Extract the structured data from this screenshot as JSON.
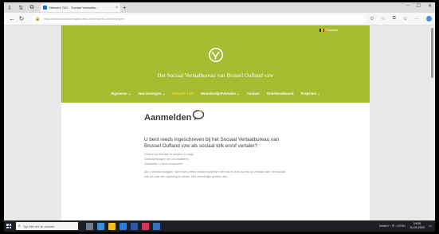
{
  "browser": {
    "tab_title": "Netwerk T&V - Sociaal Vertaalbu...",
    "tab_close": "×",
    "new_tab": "+",
    "tab_ctrl_1": "⇩",
    "tab_ctrl_2": "⇅",
    "tab_ctrl_3": "⧉",
    "url": "https://www.socialvertaalbureau.be/netwerk-tv/ontvangen/",
    "win_min": "–",
    "win_max": "☐",
    "win_close": "✕",
    "back": "←",
    "refresh": "↻",
    "more": "···"
  },
  "site": {
    "language": "Français",
    "title": "Het Sociaal Vertaalbureau van Brussel Oufland vzw",
    "nav": [
      {
        "label": "Algemeen ⌄"
      },
      {
        "label": "Voorzieningen ⌄"
      },
      {
        "label": "Netwerk T&V"
      },
      {
        "label": "Woordenlijst/Vertalen ⌄"
      },
      {
        "label": "Contact"
      },
      {
        "label": "Onbekendwoord"
      },
      {
        "label": "Projecten ⌄"
      }
    ],
    "brand": "Aanmelden",
    "question": "U bent reeds ingeschreven bij het Sociaal Vertaalbureau van Brussel Oufland vzw als sociaal tolk en/of vertaler?",
    "lines": [
      "Gelieve uw link aan te melden zo volgt:",
      "Gebruikersnaam van uw mailadres",
      "Voorbeeld: U bent vrouw verbi"
    ],
    "paragraph": "Als u niet kan inloggen, dan moet u eerst contact opnemen met ons of door uw link op verwijst naar 'Uw sociaal tolk' en naar een opleiding te kiezen. Met vriendelijke groeten aan"
  },
  "taskbar": {
    "search_placeholder": "Typ hier om te zoeken",
    "tray_text": "Nederl ^ ⊡ ◁ ENG",
    "time": "19:05",
    "date": "11-03-2020"
  },
  "colors": {
    "hero_green": "#a6bb2f",
    "nav_active": "#f4e12b"
  }
}
